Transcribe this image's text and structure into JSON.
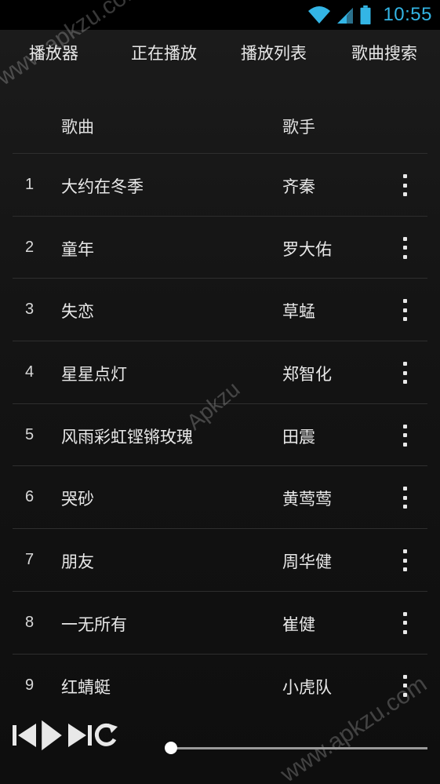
{
  "status": {
    "time": "10:55"
  },
  "tabs": [
    {
      "label": "播放器"
    },
    {
      "label": "正在播放"
    },
    {
      "label": "播放列表"
    },
    {
      "label": "歌曲搜索"
    }
  ],
  "list": {
    "columns": {
      "title": "歌曲",
      "artist": "歌手"
    },
    "rows": [
      {
        "num": "1",
        "title": "大约在冬季",
        "artist": "齐秦"
      },
      {
        "num": "2",
        "title": "童年",
        "artist": "罗大佑"
      },
      {
        "num": "3",
        "title": "失恋",
        "artist": "草蜢"
      },
      {
        "num": "4",
        "title": "星星点灯",
        "artist": "郑智化"
      },
      {
        "num": "5",
        "title": "风雨彩虹铿锵玫瑰",
        "artist": "田震"
      },
      {
        "num": "6",
        "title": "哭砂",
        "artist": "黄莺莺"
      },
      {
        "num": "7",
        "title": "朋友",
        "artist": "周华健"
      },
      {
        "num": "8",
        "title": "一无所有",
        "artist": "崔健"
      },
      {
        "num": "9",
        "title": "红蜻蜓",
        "artist": "小虎队"
      }
    ]
  },
  "player": {
    "progress": 0,
    "controls": [
      "previous-icon",
      "play-icon",
      "next-icon",
      "repeat-icon"
    ]
  },
  "watermarks": {
    "top": "www.apkzu.com",
    "middle": "Apkzu",
    "bottom": "www.apkzu.com"
  },
  "colors": {
    "accent": "#33b5e5",
    "background": "#151515"
  }
}
